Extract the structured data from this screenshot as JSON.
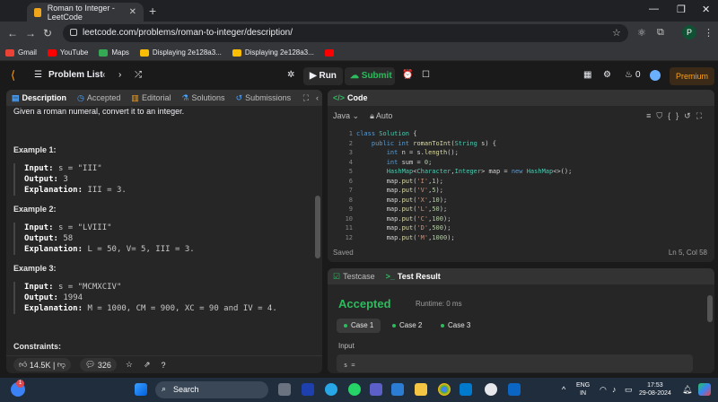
{
  "browser": {
    "tab_title": "Roman to Integer - LeetCode",
    "url": "leetcode.com/problems/roman-to-integer/description/",
    "profile_initial": "P",
    "bookmarks": [
      "Gmail",
      "YouTube",
      "Maps",
      "Displaying 2e128a3...",
      "Displaying 2e128a3..."
    ]
  },
  "lc_nav": {
    "problem_list": "Problem List",
    "run": "Run",
    "submit": "Submit",
    "streak": "0",
    "premium": "Premium"
  },
  "left_panel": {
    "tabs": [
      "Description",
      "Accepted",
      "Editorial",
      "Solutions",
      "Submissions"
    ],
    "intro": "Given a roman numeral, convert it to an integer.",
    "examples": [
      {
        "title": "Example 1:",
        "input": "s = \"III\"",
        "output": "3",
        "explanation": "III = 3."
      },
      {
        "title": "Example 2:",
        "input": "s = \"LVIII\"",
        "output": "58",
        "explanation": "L = 50, V= 5, III = 3."
      },
      {
        "title": "Example 3:",
        "input": "s = \"MCMXCIV\"",
        "output": "1994",
        "explanation": "M = 1000, CM = 900, XC = 90 and IV = 4."
      }
    ],
    "labels": {
      "input": "Input:",
      "output": "Output:",
      "explanation": "Explanation:"
    },
    "constraints": "Constraints:",
    "likes": "14.5K",
    "comments": "326"
  },
  "code_panel": {
    "title": "Code",
    "language": "Java",
    "mode": "Auto",
    "status": "Saved",
    "cursor": "Ln 5, Col 58",
    "line_numbers": [
      "1",
      "2",
      "3",
      "4",
      "5",
      "6",
      "7",
      "8",
      "9",
      "10",
      "11",
      "12"
    ]
  },
  "test_panel": {
    "tabs": [
      "Testcase",
      "Test Result"
    ],
    "result": "Accepted",
    "runtime": "Runtime: 0 ms",
    "cases": [
      "Case 1",
      "Case 2",
      "Case 3"
    ],
    "input_label": "Input",
    "input_value": "s ="
  },
  "taskbar": {
    "search": "Search",
    "lang": "ENG",
    "region": "IN",
    "time": "17:53",
    "date": "29-08-2024",
    "notif": "1"
  }
}
